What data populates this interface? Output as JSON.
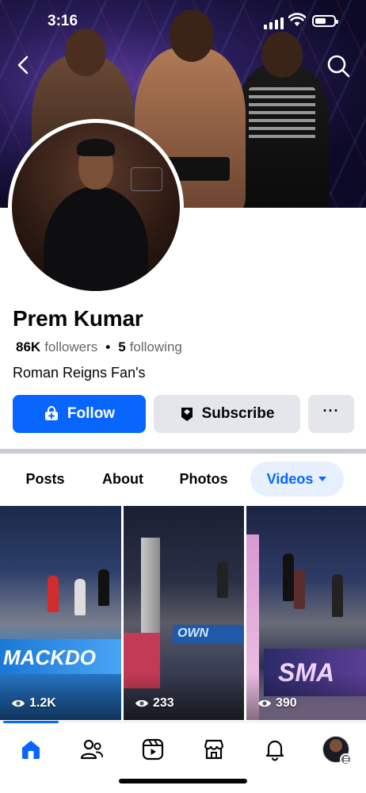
{
  "status_bar": {
    "time": "3:16"
  },
  "profile": {
    "name": "Prem Kumar",
    "followers_count": "86K",
    "followers_label": "followers",
    "following_count": "5",
    "following_label": "following",
    "separator": "•",
    "bio": "Roman Reigns Fan's"
  },
  "actions": {
    "follow_label": "Follow",
    "subscribe_label": "Subscribe",
    "more_label": "···"
  },
  "tabs": [
    {
      "label": "Posts",
      "active": false
    },
    {
      "label": "About",
      "active": false
    },
    {
      "label": "Photos",
      "active": false
    },
    {
      "label": "Videos",
      "active": true
    }
  ],
  "videos": [
    {
      "views": "1.2K",
      "overlay_text": "MACKDO"
    },
    {
      "views": "233",
      "overlay_text": "OWN"
    },
    {
      "views": "390",
      "overlay_text": "SMA"
    }
  ],
  "bottom_nav": [
    {
      "icon": "home-icon",
      "active": true
    },
    {
      "icon": "friends-icon",
      "active": false
    },
    {
      "icon": "reels-icon",
      "active": false
    },
    {
      "icon": "marketplace-icon",
      "active": false
    },
    {
      "icon": "notifications-icon",
      "active": false
    },
    {
      "icon": "profile-menu-icon",
      "active": false
    }
  ],
  "colors": {
    "accent": "#0866ff",
    "secondary_button": "#e4e6eb",
    "muted_text": "#65676b"
  }
}
